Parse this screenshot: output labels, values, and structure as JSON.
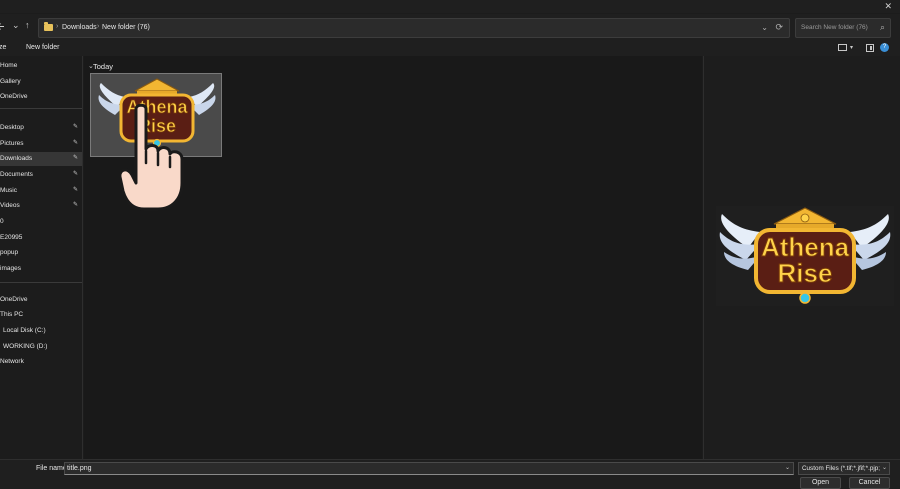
{
  "window": {
    "close_glyph": "✕"
  },
  "nav": {
    "back_icon": "arrow-left-icon",
    "forward_glyph": "›",
    "dropdown_glyph": "⌄",
    "up_glyph": "↑",
    "breadcrumb": [
      "Downloads",
      "New folder (76)"
    ],
    "separator": "›",
    "history_glyph": "⌄",
    "refresh_glyph": "⟳"
  },
  "search": {
    "placeholder": "Search New folder (76)",
    "icon_glyph": "⌕"
  },
  "commands": {
    "organize_partial": "ze",
    "new_folder": "New folder",
    "view_chev": "▾"
  },
  "sidebar": {
    "items": [
      {
        "label": "Home"
      },
      {
        "label": "Gallery"
      },
      {
        "label": "OneDrive"
      },
      {
        "label": "Desktop",
        "pinned": true
      },
      {
        "label": "Pictures",
        "pinned": true
      },
      {
        "label": "Downloads",
        "pinned": true,
        "selected": true
      },
      {
        "label": "Documents",
        "pinned": true
      },
      {
        "label": "Music",
        "pinned": true
      },
      {
        "label": "Videos",
        "pinned": true
      },
      {
        "label": "0"
      },
      {
        "label": "E20995"
      },
      {
        "label": "popup"
      },
      {
        "label": "images"
      },
      {
        "label": "OneDrive"
      },
      {
        "label": "This PC"
      },
      {
        "label": "Local Disk (C:)"
      },
      {
        "label": "WORKING (D:)"
      },
      {
        "label": "Network"
      }
    ],
    "pin_glyph": "📌"
  },
  "content": {
    "group_label": "Today",
    "group_chev": "⌄",
    "file": {
      "name": "title.png",
      "logo_line1": "Athena",
      "logo_line2": "Rise"
    }
  },
  "preview": {
    "logo_line1": "Athena",
    "logo_line2": "Rise"
  },
  "footer": {
    "file_name_label": "File name:",
    "file_name_value": "title.png",
    "dropdown_glyph": "⌄",
    "filter_value": "Custom Files (*.tif;*.jfif;*.pjp;*.a",
    "open_label": "Open",
    "cancel_label": "Cancel"
  },
  "colors": {
    "folder": "#e8c25b",
    "accent": "#3a8fd6",
    "gold": "#f2b632",
    "maroon": "#5a1e14"
  }
}
